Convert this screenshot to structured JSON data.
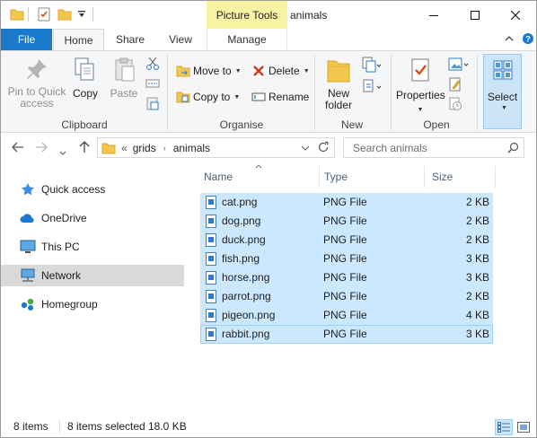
{
  "window": {
    "title": "animals"
  },
  "context_tab": "Picture Tools",
  "tabs": {
    "file": "File",
    "home": "Home",
    "share": "Share",
    "view": "View",
    "manage": "Manage"
  },
  "ribbon": {
    "clipboard": {
      "label": "Clipboard",
      "pin": "Pin to Quick access",
      "copy": "Copy",
      "paste": "Paste"
    },
    "organise": {
      "label": "Organise",
      "move_to": "Move to",
      "copy_to": "Copy to",
      "delete": "Delete",
      "rename": "Rename"
    },
    "new": {
      "label": "New",
      "new_folder": "New folder"
    },
    "open": {
      "label": "Open",
      "properties": "Properties"
    },
    "select": {
      "label": "Select"
    }
  },
  "address": {
    "overflow": "«",
    "crumbs": [
      "grids",
      "animals"
    ]
  },
  "search": {
    "placeholder": "Search animals"
  },
  "nav": [
    {
      "label": "Quick access",
      "icon": "star-icon"
    },
    {
      "label": "OneDrive",
      "icon": "cloud-icon"
    },
    {
      "label": "This PC",
      "icon": "computer-icon"
    },
    {
      "label": "Network",
      "icon": "network-icon"
    },
    {
      "label": "Homegroup",
      "icon": "homegroup-icon"
    }
  ],
  "columns": {
    "name": "Name",
    "type": "Type",
    "size": "Size"
  },
  "files": [
    {
      "name": "cat.png",
      "type": "PNG File",
      "size": "2 KB"
    },
    {
      "name": "dog.png",
      "type": "PNG File",
      "size": "2 KB"
    },
    {
      "name": "duck.png",
      "type": "PNG File",
      "size": "2 KB"
    },
    {
      "name": "fish.png",
      "type": "PNG File",
      "size": "3 KB"
    },
    {
      "name": "horse.png",
      "type": "PNG File",
      "size": "3 KB"
    },
    {
      "name": "parrot.png",
      "type": "PNG File",
      "size": "2 KB"
    },
    {
      "name": "pigeon.png",
      "type": "PNG File",
      "size": "4 KB"
    },
    {
      "name": "rabbit.png",
      "type": "PNG File",
      "size": "3 KB"
    }
  ],
  "status": {
    "count": "8 items",
    "selected": "8 items selected",
    "size": "18.0 KB"
  },
  "colors": {
    "accent": "#1979ca",
    "selection": "#cce8ff",
    "context_tab": "#f8f3a2"
  }
}
